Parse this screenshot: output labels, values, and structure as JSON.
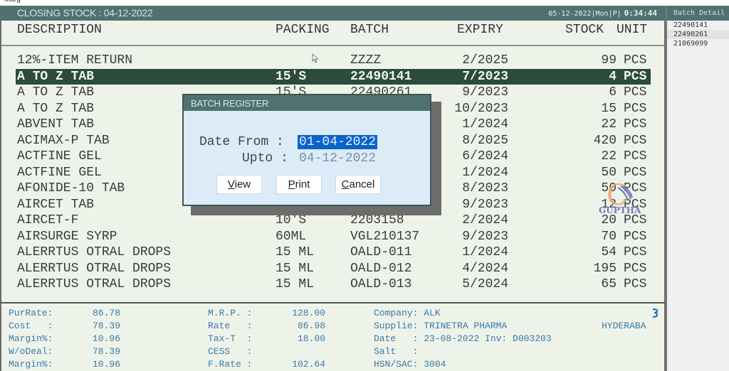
{
  "app": {
    "name": "Marg",
    "window_title": "CLOSING STOCK : 04-12-2022",
    "status_date": "05-12-2022|Mon|P|",
    "status_clock": "0:34:44"
  },
  "table": {
    "columns": {
      "description": "DESCRIPTION",
      "packing": "PACKING",
      "batch": "BATCH",
      "expiry": "EXPIRY",
      "stock": "STOCK",
      "unit": "UNIT"
    },
    "rows": [
      {
        "description": "12%-ITEM RETURN",
        "packing": "",
        "batch": "ZZZZ",
        "expiry": "2/2025",
        "stock": "99",
        "unit": "PCS",
        "selected": false
      },
      {
        "description": "A TO Z TAB",
        "packing": "15'S",
        "batch": "22490141",
        "expiry": "7/2023",
        "stock": "4",
        "unit": "PCS",
        "selected": true
      },
      {
        "description": "A TO Z TAB",
        "packing": "15'S",
        "batch": "22490261",
        "expiry": "9/2023",
        "stock": "6",
        "unit": "PCS",
        "selected": false
      },
      {
        "description": "A TO Z TAB",
        "packing": "",
        "batch": "",
        "expiry": "10/2023",
        "stock": "15",
        "unit": "PCS",
        "selected": false
      },
      {
        "description": "ABVENT TAB",
        "packing": "",
        "batch": "",
        "expiry": "1/2024",
        "stock": "22",
        "unit": "PCS",
        "selected": false
      },
      {
        "description": "ACIMAX-P TAB",
        "packing": "",
        "batch": "",
        "expiry": "8/2025",
        "stock": "420",
        "unit": "PCS",
        "selected": false
      },
      {
        "description": "ACTFINE GEL",
        "packing": "",
        "batch": "",
        "expiry": "6/2024",
        "stock": "22",
        "unit": "PCS",
        "selected": false
      },
      {
        "description": "ACTFINE GEL",
        "packing": "",
        "batch": "",
        "expiry": "1/2024",
        "stock": "50",
        "unit": "PCS",
        "selected": false
      },
      {
        "description": "AFONIDE-10 TAB",
        "packing": "",
        "batch": "",
        "expiry": "8/2023",
        "stock": "50",
        "unit": "PCS",
        "selected": false
      },
      {
        "description": "AIRCET TAB",
        "packing": "",
        "batch": "",
        "expiry": "9/2023",
        "stock": "12",
        "unit": "PCS",
        "selected": false
      },
      {
        "description": "AIRCET-F",
        "packing": "10'S",
        "batch": "2203158",
        "expiry": "2/2024",
        "stock": "20",
        "unit": "PCS",
        "selected": false
      },
      {
        "description": "AIRSURGE SYRP",
        "packing": "60ML",
        "batch": "VGL210137",
        "expiry": "9/2023",
        "stock": "70",
        "unit": "PCS",
        "selected": false
      },
      {
        "description": "ALERRTUS OTRAL DROPS",
        "packing": "15 ML",
        "batch": "OALD-011",
        "expiry": "1/2024",
        "stock": "54",
        "unit": "PCS",
        "selected": false
      },
      {
        "description": "ALERRTUS OTRAL DROPS",
        "packing": "15 ML",
        "batch": "OALD-012",
        "expiry": "4/2024",
        "stock": "195",
        "unit": "PCS",
        "selected": false
      },
      {
        "description": "ALERRTUS OTRAL DROPS",
        "packing": "15 ML",
        "batch": "OALD-013",
        "expiry": "5/2024",
        "stock": "65",
        "unit": "PCS",
        "selected": false
      }
    ]
  },
  "batch_detail": {
    "title": "Batch Detail",
    "items": [
      "22490141",
      "22490261",
      "21069099"
    ]
  },
  "info": {
    "col1": [
      {
        "label": "PurRate:",
        "value": "86.78"
      },
      {
        "label": "Cost   :",
        "value": "78.39"
      },
      {
        "label": "Margin%:",
        "value": "10.96"
      },
      {
        "label": "W/oDeal:",
        "value": "78.39"
      },
      {
        "label": "Margin%:",
        "value": "10.96"
      }
    ],
    "col2": [
      {
        "label": "M.R.P. :",
        "value": "128.00"
      },
      {
        "label": "Rate   :",
        "value": "86.98"
      },
      {
        "label": "Tax-T  :",
        "value": "18.00"
      },
      {
        "label": "CESS   :",
        "value": ""
      },
      {
        "label": "F.Rate :",
        "value": "102.64"
      }
    ],
    "col3": [
      "Company: ALK",
      "Supplie: TRINETRA PHARMA",
      "Date   : 23-08-2022 Inv: D003203",
      "Salt   :",
      "HSN/SAC: 3004"
    ],
    "supplier_city": "HYDERABA"
  },
  "dialog": {
    "title": "BATCH REGISTER",
    "date_from_label": "Date From :",
    "date_from_value": "01-04-2022",
    "upto_label": "Upto :",
    "upto_value": "04-12-2022",
    "buttons": {
      "view": {
        "accel": "V",
        "rest": "iew"
      },
      "print": {
        "accel": "P",
        "rest": "rint"
      },
      "cancel": {
        "accel": "C",
        "rest": "ancel"
      }
    }
  },
  "watermark": {
    "text": "GUPTHA"
  },
  "colors": {
    "title_bar": "#4f7270",
    "selected_row": "#2c4a3d",
    "panel_bg": "#eef3ea",
    "info_text": "#3a78a8",
    "dialog_bg": "#dcebf8",
    "input_highlight": "#0a63c9"
  }
}
